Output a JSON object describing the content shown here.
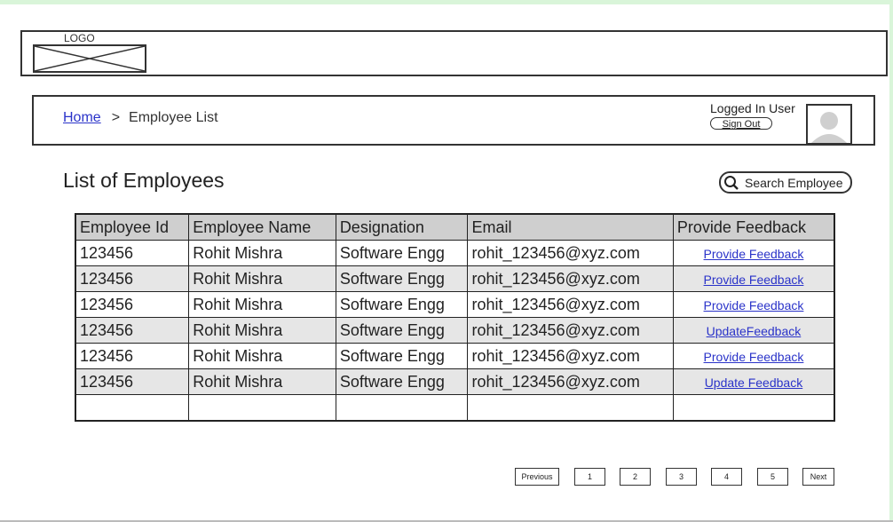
{
  "logo": {
    "label": "LOGO"
  },
  "breadcrumb": {
    "home": "Home",
    "separator": ">",
    "current": "Employee List"
  },
  "user": {
    "label": "Logged In User",
    "signout": "Sign Out"
  },
  "page": {
    "title": "List of Employees"
  },
  "search": {
    "placeholder": "Search Employee"
  },
  "table": {
    "headers": [
      "Employee Id",
      "Employee Name",
      "Designation",
      "Email",
      "Provide Feedback"
    ],
    "rows": [
      {
        "id": "123456",
        "name": "Rohit Mishra",
        "designation": "Software Engg",
        "email": "rohit_123456@xyz.com",
        "action": "Provide Feedback"
      },
      {
        "id": "123456",
        "name": "Rohit Mishra",
        "designation": "Software Engg",
        "email": "rohit_123456@xyz.com",
        "action": "Provide Feedback"
      },
      {
        "id": "123456",
        "name": "Rohit Mishra",
        "designation": "Software Engg",
        "email": "rohit_123456@xyz.com",
        "action": "Provide Feedback"
      },
      {
        "id": "123456",
        "name": "Rohit Mishra",
        "designation": "Software Engg",
        "email": "rohit_123456@xyz.com",
        "action": "UpdateFeedback"
      },
      {
        "id": "123456",
        "name": "Rohit Mishra",
        "designation": "Software Engg",
        "email": "rohit_123456@xyz.com",
        "action": "Provide Feedback"
      },
      {
        "id": "123456",
        "name": "Rohit Mishra",
        "designation": "Software Engg",
        "email": "rohit_123456@xyz.com",
        "action": "Update Feedback"
      }
    ]
  },
  "pagination": {
    "previous": "Previous",
    "pages": [
      "1",
      "2",
      "3",
      "4",
      "5"
    ],
    "next": "Next"
  },
  "colors": {
    "link": "#2a33c9",
    "header_bg": "#cfcfcf",
    "alt_row_bg": "#e6e6e6",
    "frame": "#d9f5d9"
  }
}
